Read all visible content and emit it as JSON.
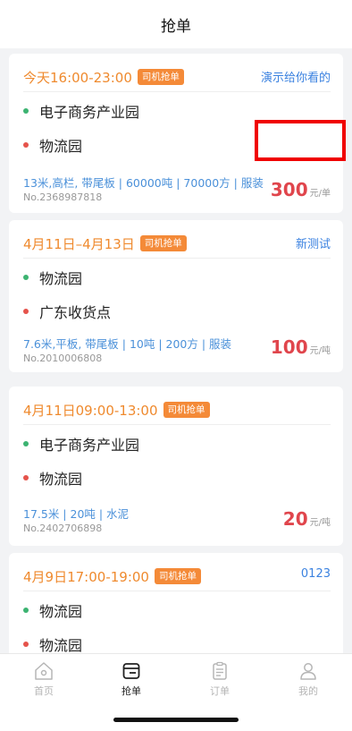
{
  "header": {
    "title": "抢单"
  },
  "orders": [
    {
      "time": "今天16:00-23:00",
      "tag": "司机抢单",
      "note": "演示给你看的",
      "from": "电子商务产业园",
      "to": "物流园",
      "spec": "13米,高栏, 带尾板 | 60000吨 | 70000方 | 服装",
      "order_no": "No.2368987818",
      "price": "300",
      "unit": "元/单"
    },
    {
      "time": "4月11日–4月13日",
      "tag": "司机抢单",
      "note": "新测试",
      "from": "物流园",
      "to": "广东收货点",
      "spec": "7.6米,平板, 带尾板 | 10吨 | 200方 | 服装",
      "order_no": "No.2010006808",
      "price": "100",
      "unit": "元/吨"
    },
    {
      "time": "4月11日09:00-13:00",
      "tag": "司机抢单",
      "note": "",
      "from": "电子商务产业园",
      "to": "物流园",
      "spec": "17.5米 | 20吨 | 水泥",
      "order_no": "No.2402706898",
      "price": "20",
      "unit": "元/吨"
    },
    {
      "time": "4月9日17:00-19:00",
      "tag": "司机抢单",
      "note": "0123",
      "from": "物流园",
      "to": "物流园"
    }
  ],
  "tabbar": {
    "items": [
      {
        "label": "首页",
        "icon": "home-icon"
      },
      {
        "label": "抢单",
        "icon": "grab-order-icon"
      },
      {
        "label": "订单",
        "icon": "order-icon"
      },
      {
        "label": "我的",
        "icon": "profile-icon"
      }
    ],
    "active_color": "#222222",
    "inactive_color": "#b5b5b5"
  },
  "colors": {
    "accent_orange": "#ef8a2e",
    "link_blue": "#3b82e0",
    "price_red": "#e0454c"
  }
}
